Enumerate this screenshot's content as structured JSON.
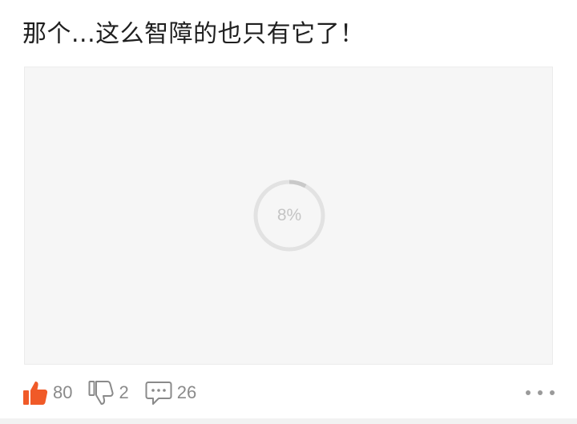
{
  "post": {
    "title": "那个...这么智障的也只有它了！"
  },
  "media": {
    "loading_label": "8%",
    "progress": 0.08
  },
  "actions": {
    "like_count": "80",
    "dislike_count": "2",
    "comment_count": "26"
  },
  "colors": {
    "like_icon": "#f05a28",
    "icon_gray": "#8a8a8a",
    "loader_track": "#e2e2e2",
    "loader_arc": "#c9c9c9"
  },
  "icons": {
    "like": "thumbs-up-icon",
    "dislike": "thumbs-down-icon",
    "comment": "comment-icon",
    "more": "more-dots-icon"
  }
}
